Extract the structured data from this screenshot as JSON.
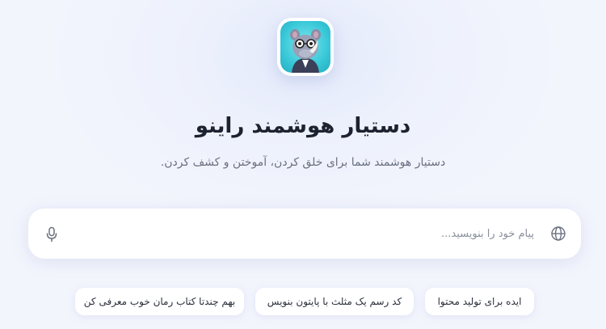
{
  "header": {
    "logo_icon": "rhino-mascot-icon",
    "title": "دستیار هوشمند راینو",
    "subtitle": "دستیار هوشمند شما برای خلق کردن، آموختن و کشف کردن."
  },
  "input": {
    "placeholder": "پیام خود را بنویسید...",
    "value": "",
    "left_icon": "microphone-icon",
    "right_icon": "globe-icon"
  },
  "suggestions": [
    {
      "label": "ایده برای تولید محتوا"
    },
    {
      "label": "کد رسم یک مثلث با پایتون بنویس"
    },
    {
      "label": "بهم چندتا کتاب رمان خوب معرفی کن"
    }
  ],
  "colors": {
    "background": "#eef2fc",
    "logo_bg": "#39c8d8",
    "title": "#1d2230",
    "subtitle": "#6a7080"
  }
}
